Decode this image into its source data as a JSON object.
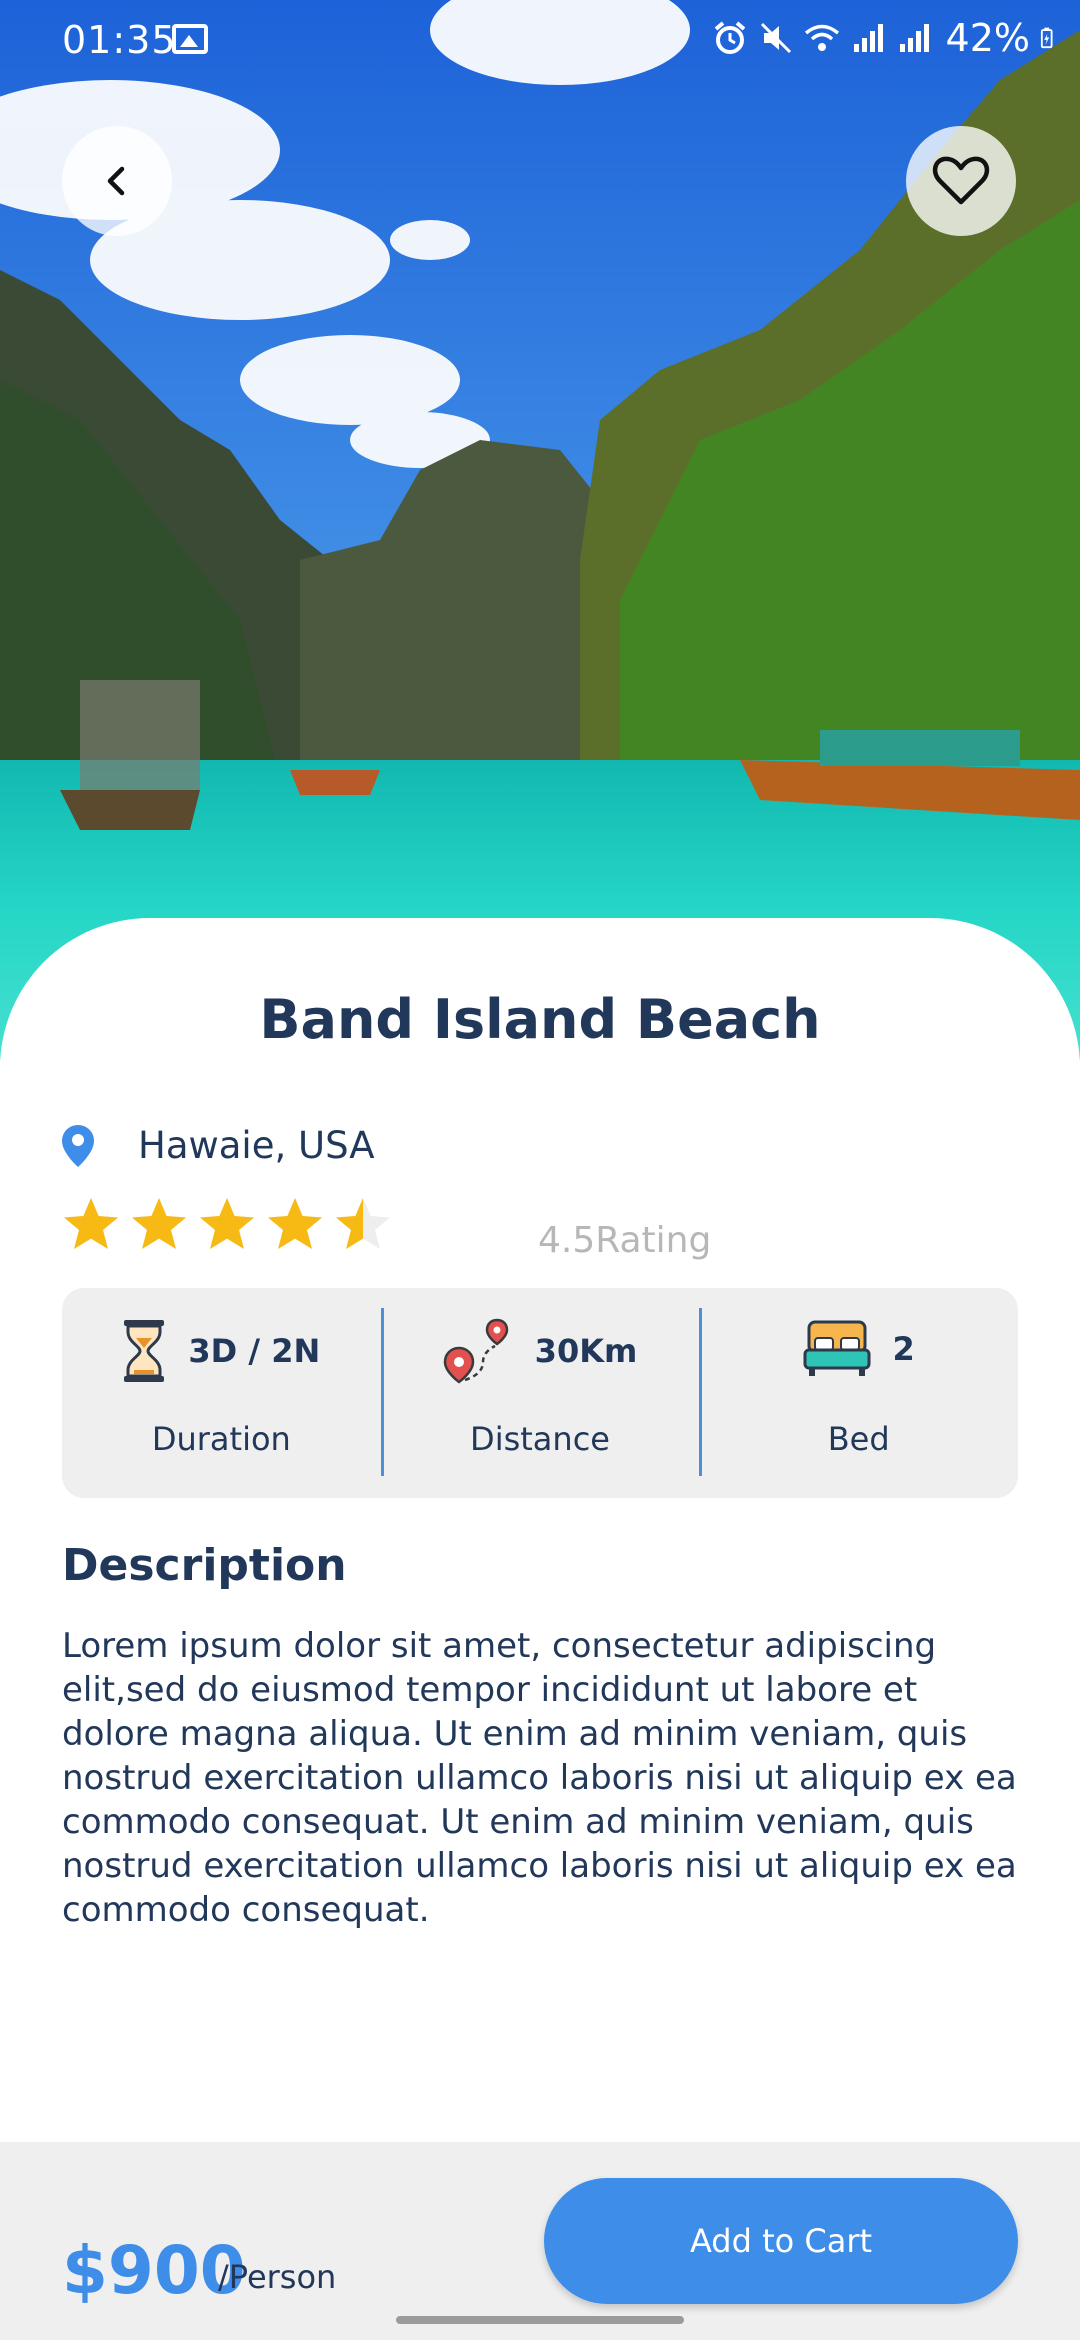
{
  "status_bar": {
    "time": "01:35",
    "battery": "42%",
    "icons": [
      "gallery-icon",
      "alarm-icon",
      "mute-icon",
      "wifi-icon",
      "signal-icon",
      "signal-icon",
      "battery-icon"
    ]
  },
  "header": {
    "back_icon": "chevron-left-icon",
    "favorite_icon": "heart-outline-icon"
  },
  "place": {
    "title": "Band Island Beach",
    "location": "Hawaie, USA",
    "rating_value": 4.5,
    "rating_max": 5,
    "rating_text": "4.5Rating"
  },
  "stats": [
    {
      "value": "3D / 2N",
      "label": "Duration",
      "icon": "hourglass-icon"
    },
    {
      "value": "30Km",
      "label": "Distance",
      "icon": "route-pins-icon"
    },
    {
      "value": "2",
      "label": "Bed",
      "icon": "bed-icon"
    }
  ],
  "description": {
    "title": "Description",
    "body": "Lorem ipsum dolor sit amet, consectetur adipiscing elit,sed do eiusmod tempor incididunt ut labore et dolore magna aliqua. Ut enim ad minim veniam, quis nostrud exercitation ullamco laboris nisi ut aliquip  ex ea commodo consequat. Ut enim ad minim  veniam, quis nostrud exercitation ullamco laboris  nisi ut aliquip ex ea commodo consequat."
  },
  "footer": {
    "price": "$900",
    "per": "/Person",
    "cta": "Add to Cart"
  },
  "colors": {
    "accent": "#3e8de8",
    "text": "#22385a",
    "star": "#f7b914",
    "divider": "#4a90d9"
  }
}
